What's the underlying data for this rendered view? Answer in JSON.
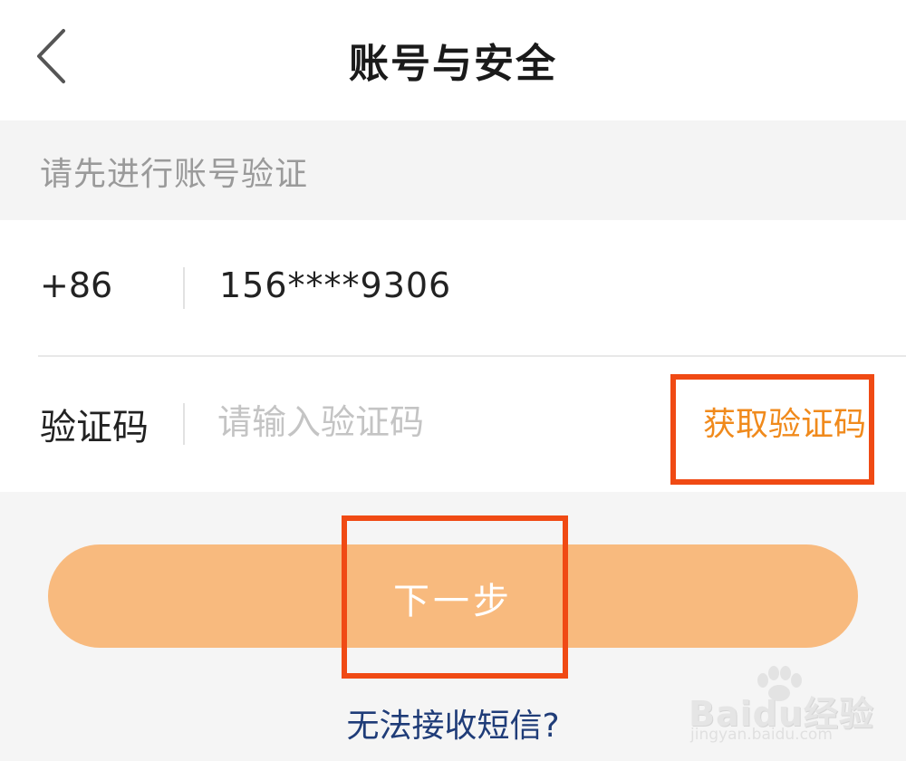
{
  "header": {
    "title": "账号与安全",
    "back_icon": "chevron-left-icon"
  },
  "hint": {
    "text": "请先进行账号验证"
  },
  "form": {
    "phone": {
      "country_code": "+86",
      "number": "156****9306"
    },
    "code": {
      "label": "验证码",
      "placeholder": "请输入验证码",
      "value": "",
      "get_code_label": "获取验证码"
    }
  },
  "actions": {
    "next_label": "下一步",
    "sms_help_label": "无法接收短信?"
  },
  "watermark": {
    "brand": "Baidu经验",
    "url": "jingyan.baidu.com"
  },
  "colors": {
    "accent_orange": "#f08a1c",
    "next_button": "#f8ba7e",
    "highlight_box": "#f04a14",
    "link_blue": "#1f3c78"
  }
}
